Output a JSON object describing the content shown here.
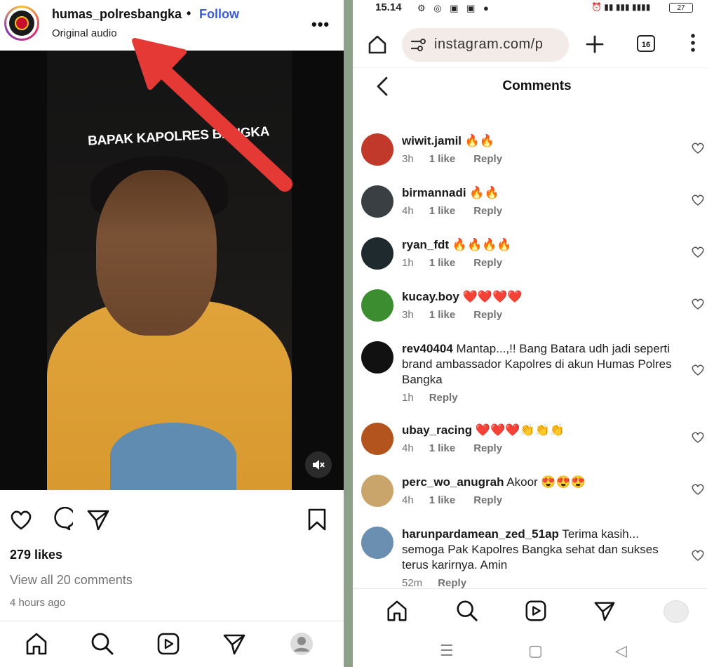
{
  "post": {
    "username": "humas_polresbangka",
    "separator": "•",
    "follow_label": "Follow",
    "audio_label": "Original audio",
    "more_label": "•••",
    "video_overlay_text": "BAPAK KAPOLRES BANGKA",
    "likes": "279 likes",
    "view_comments": "View all 20 comments",
    "time_ago": "4 hours ago"
  },
  "status": {
    "time": "15.14",
    "battery": "27"
  },
  "browser": {
    "url": "instagram.com/p",
    "tab_count": "16"
  },
  "comments_screen": {
    "title": "Comments",
    "items": [
      {
        "user": "wiwit.jamil",
        "text": "🔥🔥",
        "time": "3h",
        "likes": "1 like",
        "reply": "Reply",
        "avatar_color": "#c0392b"
      },
      {
        "user": "birmannadi",
        "text": "🔥🔥",
        "time": "4h",
        "likes": "1 like",
        "reply": "Reply",
        "avatar_color": "#3a3f44"
      },
      {
        "user": "ryan_fdt",
        "text": "🔥🔥🔥🔥",
        "time": "1h",
        "likes": "1 like",
        "reply": "Reply",
        "avatar_color": "#1f2a2e"
      },
      {
        "user": "kucay.boy",
        "text": "❤️❤️❤️❤️",
        "time": "3h",
        "likes": "1 like",
        "reply": "Reply",
        "avatar_color": "#3c8d2f"
      },
      {
        "user": "rev40404",
        "text": "Mantap...,!! Bang Batara udh jadi seperti brand ambassador Kapolres di akun Humas Polres Bangka",
        "time": "1h",
        "likes": "",
        "reply": "Reply",
        "avatar_color": "#111111"
      },
      {
        "user": "ubay_racing",
        "text": "❤️❤️❤️👏👏👏",
        "time": "4h",
        "likes": "1 like",
        "reply": "Reply",
        "avatar_color": "#b3541e"
      },
      {
        "user": "perc_wo_anugrah",
        "text": "Akoor 😍😍😍",
        "time": "4h",
        "likes": "1 like",
        "reply": "Reply",
        "avatar_color": "#c9a56b"
      },
      {
        "user": "harunpardamean_zed_51ap",
        "text": "Terima kasih... semoga Pak Kapolres Bangka sehat dan sukses terus karirnya. Amin",
        "time": "52m",
        "likes": "",
        "reply": "Reply",
        "avatar_color": "#6a8fb0"
      }
    ]
  },
  "colors": {
    "follow": "#3b5bdb",
    "arrow": "#e53935",
    "meta_gray": "#737373"
  }
}
